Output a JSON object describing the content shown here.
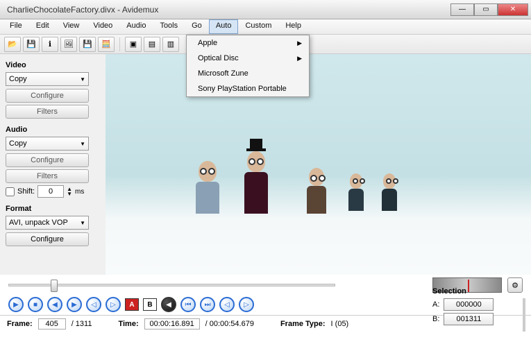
{
  "window": {
    "title": "CharlieChocolateFactory.divx - Avidemux"
  },
  "menu": {
    "items": [
      "File",
      "Edit",
      "View",
      "Video",
      "Audio",
      "Tools",
      "Go",
      "Auto",
      "Custom",
      "Help"
    ],
    "active_index": 7,
    "dropdown": {
      "items": [
        {
          "label": "Apple",
          "has_submenu": true
        },
        {
          "label": "Optical Disc",
          "has_submenu": true
        },
        {
          "label": "Microsoft Zune",
          "has_submenu": false
        },
        {
          "label": "Sony PlayStation Portable",
          "has_submenu": false
        }
      ]
    }
  },
  "sidebar": {
    "video": {
      "label": "Video",
      "codec": "Copy",
      "configure": "Configure",
      "filters": "Filters"
    },
    "audio": {
      "label": "Audio",
      "codec": "Copy",
      "configure": "Configure",
      "filters": "Filters",
      "shift_label": "Shift:",
      "shift_value": "0",
      "shift_unit": "ms"
    },
    "format": {
      "label": "Format",
      "container": "AVI, unpack VOP",
      "configure": "Configure"
    }
  },
  "selection": {
    "label": "Selection",
    "a_label": "A:",
    "a_value": "000000",
    "b_label": "B:",
    "b_value": "001311"
  },
  "status": {
    "frame_label": "Frame:",
    "frame_value": "405",
    "frame_total": "/ 1311",
    "time_label": "Time:",
    "time_value": "00:00:16.891",
    "time_total": "/ 00:00:54.679",
    "frametype_label": "Frame Type:",
    "frametype_value": "I (05)"
  },
  "markers": {
    "a": "A",
    "b": "B"
  },
  "icons": {
    "open": "📂",
    "save": "💾",
    "info": "ℹ",
    "picture": "🖼",
    "disk": "💾",
    "calc": "🧮",
    "play": "▶",
    "stop": "■",
    "prev": "◀",
    "next": "▶",
    "first": "⏮",
    "last": "⏭",
    "prevkey": "◁",
    "nextkey": "▷",
    "prevblack": "◀",
    "nextblack": "▶",
    "gear": "⚙"
  }
}
